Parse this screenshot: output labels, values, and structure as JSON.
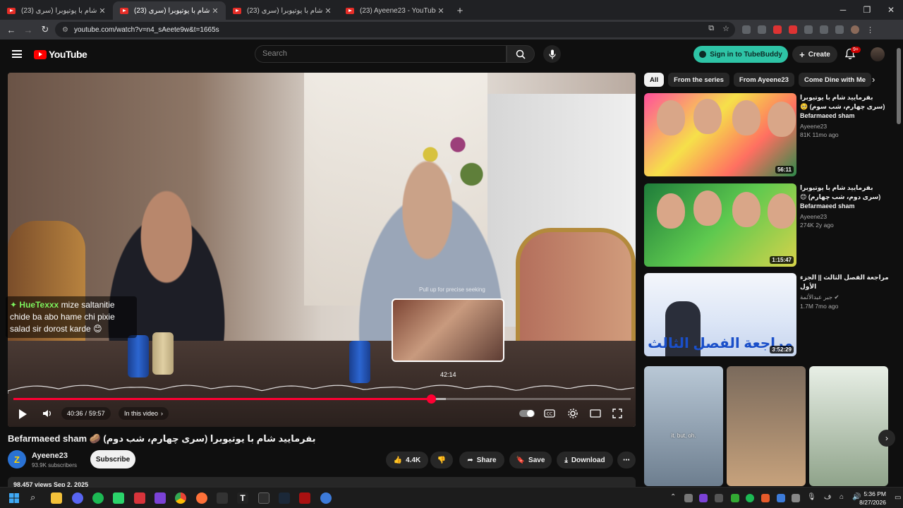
{
  "browser": {
    "tabs": [
      {
        "title": "(23) بفرمایید شام با یوتیوبرا (سری"
      },
      {
        "title": "(23) بفرمایید شام با یوتیوبرا (سری",
        "active": true
      },
      {
        "title": "(23) بفرمایید شام با یوتیوبرا (سری"
      },
      {
        "title": "(23) Ayeene23 - YouTube"
      }
    ],
    "url": "youtube.com/watch?v=n4_sAeete9w&t=1665s"
  },
  "header": {
    "logo_text": "YouTube",
    "search_placeholder": "Search",
    "tubebuddy_label": "Sign in to TubeBuddy",
    "create_label": "Create",
    "notif_badge": "9+"
  },
  "player": {
    "chat_author": "HueTexxx",
    "chat_text": "mize saltanitie chide ba abo hame chi pixie salad sir dorost karde",
    "seek_hint": "Pull up for precise seeking",
    "preview_time": "42:14",
    "current_time": "40:36",
    "duration": "59:57",
    "chapter_label": "In this video",
    "progress_played": 0.676,
    "progress_loaded": 0.7
  },
  "video": {
    "title": "Befarmaeed sham 🥔 بفرمایید شام با یوتیوبرا (سری چهارم، شب دوم)",
    "channel_name": "Ayeene23",
    "channel_subs": "93.9K subscribers",
    "subscribe_label": "Subscribe",
    "likes": "4.4K",
    "share_label": "Share",
    "save_label": "Save",
    "download_label": "Download",
    "views_date": "98,457 views  Sep 2, 2025"
  },
  "sidebar": {
    "chips": [
      "All",
      "From the series",
      "From Ayeene23",
      "Come Dine with Me"
    ],
    "recommendations": [
      {
        "title": "بفرمایید شام با یوتیوبرا (سری چهارم، شب سوم) 🥺 Befarmaeed sham",
        "channel": "Ayeene23",
        "meta": "81K  11mo ago",
        "duration": "56:11"
      },
      {
        "title": "بفرمایید شام با یوتیوبرا (سری دوم، شب چهارم) 😊 Befarmaeed sham",
        "channel": "Ayeene23",
        "meta": "274K  2y ago",
        "duration": "1:15:47"
      },
      {
        "title": "مراجعة الفصل الثالث || الجزء الأول",
        "channel": "جبر عبدالأئمة",
        "meta": "1.7M  7mo ago",
        "duration": "3:52:29"
      }
    ],
    "thumb3_text": "مراجعة الفصل الثالث",
    "shelf_caption": "it. but, oh."
  },
  "taskbar": {
    "time": "5:36 PM",
    "date": "8/27/2026"
  }
}
